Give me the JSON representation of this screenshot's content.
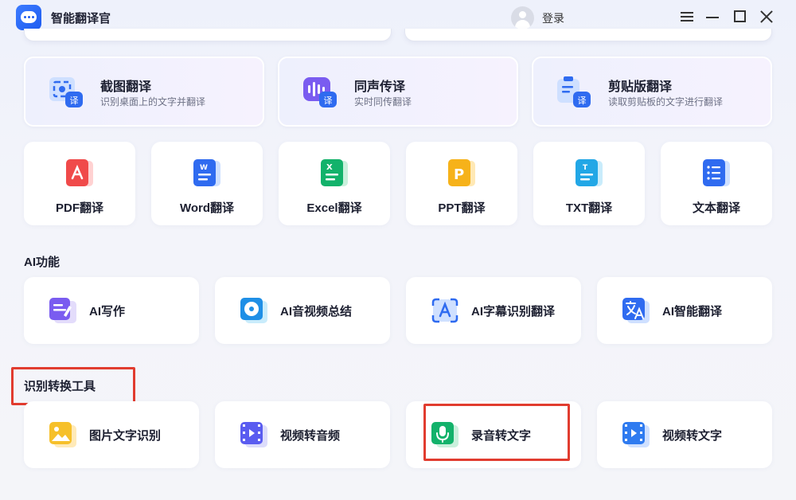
{
  "app": {
    "title": "智能翻译官",
    "login_label": "登录"
  },
  "features": [
    {
      "title": "截图翻译",
      "desc": "识别桌面上的文字并翻译",
      "badge": "译"
    },
    {
      "title": "同声传译",
      "desc": "实时同传翻译",
      "badge": "译"
    },
    {
      "title": "剪贴版翻译",
      "desc": "读取剪贴板的文字进行翻译",
      "badge": "译"
    }
  ],
  "docs": [
    {
      "label": "PDF翻译",
      "glyph": "",
      "color": "#f04a4a"
    },
    {
      "label": "Word翻译",
      "glyph": "W",
      "color": "#2f6bf0"
    },
    {
      "label": "Excel翻译",
      "glyph": "X",
      "color": "#13b26b"
    },
    {
      "label": "PPT翻译",
      "glyph": "P",
      "color": "#f6b21a"
    },
    {
      "label": "TXT翻译",
      "glyph": "T",
      "color": "#22a7e6"
    },
    {
      "label": "文本翻译",
      "glyph": "",
      "color": "#2f6bf0"
    }
  ],
  "ai_section": {
    "title": "AI功能",
    "items": [
      "AI写作",
      "AI音视频总结",
      "AI字幕识别翻译",
      "AI智能翻译"
    ]
  },
  "recog_section": {
    "title": "识别转换工具",
    "items": [
      "图片文字识别",
      "视频转音频",
      "录音转文字",
      "视频转文字"
    ]
  },
  "colors": {
    "highlight": "#e13c2f",
    "accent": "#2f6bf0"
  }
}
